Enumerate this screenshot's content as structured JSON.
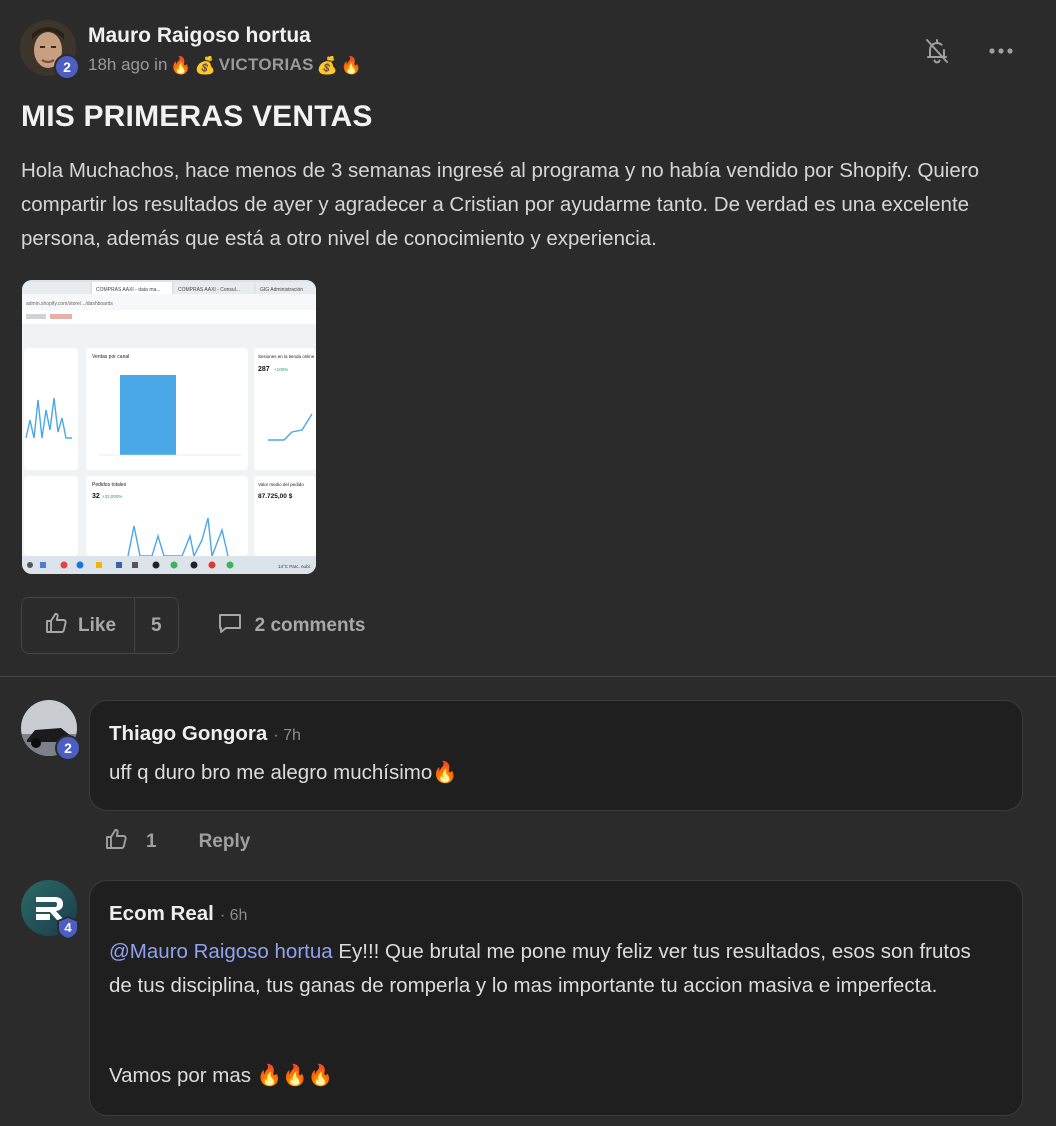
{
  "post": {
    "author": "Mauro Raigoso hortua",
    "author_level": "2",
    "time": "18h ago in",
    "category": "VICTORIAS",
    "title": "MIS PRIMERAS VENTAS",
    "body": "Hola Muchachos, hace menos de 3 semanas ingresé al programa y no había vendido por Shopify. Quiero compartir los resultados de ayer y agradecer a Cristian por ayudarme tanto. De verdad es una excelente persona, además que está a otro nivel de conocimiento y experiencia.",
    "like_label": "Like",
    "like_count": "5",
    "comments_label": "2 comments"
  },
  "attachment": {
    "tabs": [
      "COMPRAS AAXI - data ma...",
      "COMPRAS AAXI - Consul...",
      "GIG Administración"
    ],
    "url": "admin.shopify.com/store/.../dashboards",
    "card1_title": "Ventas por canal",
    "card2_title": "Sesiones en la tienda online",
    "card2_value": "287",
    "card2_delta": "+100%",
    "card3_title": "Pedidos totales",
    "card3_value": "32",
    "card3_delta": "+32,000%",
    "card4_title": "Valor medio del pedido",
    "card4_value": "87.725,00 $",
    "card4_delta": "+100%",
    "taskbar_weather": "14°C Parc. nubl."
  },
  "comments": [
    {
      "author": "Thiago Gongora",
      "level": "2",
      "time": "· 7h",
      "text": "uff q duro bro me alegro muchísimo🔥",
      "like_count": "1",
      "reply_label": "Reply"
    },
    {
      "author": "Ecom Real",
      "level": "4",
      "time": "· 6h",
      "mention": "@Mauro Raigoso hortua",
      "text": " Ey!!! Que brutal me pone muy feliz ver tus resultados, esos son frutos de tus disciplina, tus ganas de romperla y lo mas importante tu accion masiva e imperfecta.",
      "text2": "Vamos por mas 🔥🔥🔥"
    }
  ],
  "colors": {
    "background": "#2b2b2b",
    "bubble": "#1f1f1f",
    "badge": "#4a5fc1",
    "mention": "#8fa3f0",
    "chart_blue": "#4aa8e8"
  },
  "icons": [
    "bell-off-icon",
    "more-icon",
    "thumbs-up-icon",
    "comment-icon",
    "fire-emoji",
    "money-bag-emoji"
  ]
}
